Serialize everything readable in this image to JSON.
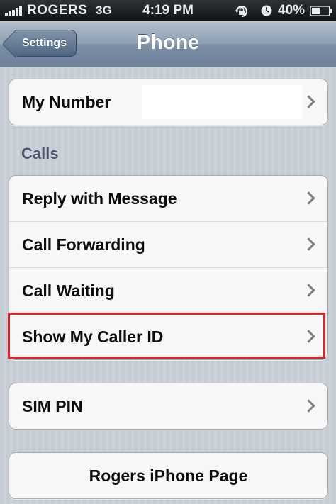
{
  "status_bar": {
    "carrier": "ROGERS",
    "network": "3G",
    "time": "4:19 PM",
    "battery_percent": "40%",
    "icons": [
      "signal-icon",
      "rotation-lock-icon",
      "alarm-icon",
      "battery-icon"
    ],
    "signal_bars": 5
  },
  "nav_bar": {
    "back_label": "Settings",
    "title": "Phone"
  },
  "groups": {
    "account": {
      "rows": [
        {
          "label": "My Number",
          "value": ""
        }
      ]
    },
    "calls": {
      "header": "Calls",
      "rows": [
        {
          "label": "Reply with Message"
        },
        {
          "label": "Call Forwarding"
        },
        {
          "label": "Call Waiting"
        },
        {
          "label": "Show My Caller ID",
          "highlighted": true
        }
      ]
    },
    "sim": {
      "rows": [
        {
          "label": "SIM PIN"
        }
      ]
    },
    "carrier": {
      "rows": [
        {
          "label": "Rogers iPhone Page"
        }
      ]
    }
  },
  "colors": {
    "highlight": "#e02226",
    "nav_bar": "#7c8fa5",
    "background": "#c5ccd4"
  }
}
